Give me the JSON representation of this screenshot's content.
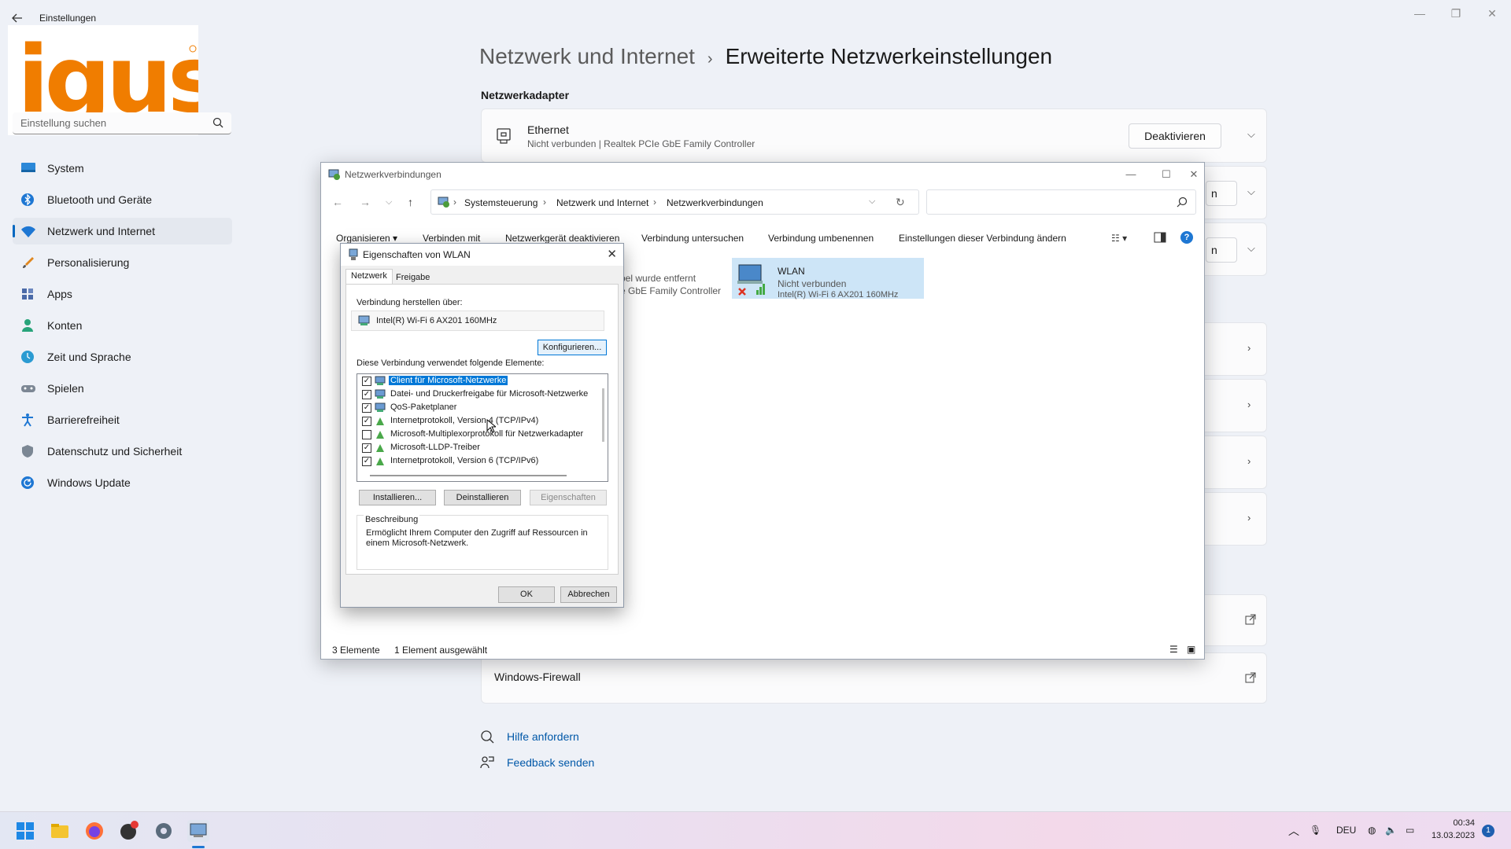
{
  "settings": {
    "title": "Einstellungen",
    "search_placeholder": "Einstellung suchen",
    "nav": [
      {
        "label": "System",
        "icon": "monitor-icon"
      },
      {
        "label": "Bluetooth und Geräte",
        "icon": "bluetooth-icon"
      },
      {
        "label": "Netzwerk und Internet",
        "icon": "wifi-icon"
      },
      {
        "label": "Personalisierung",
        "icon": "brush-icon"
      },
      {
        "label": "Apps",
        "icon": "apps-icon"
      },
      {
        "label": "Konten",
        "icon": "person-icon"
      },
      {
        "label": "Zeit und Sprache",
        "icon": "globe-clock-icon"
      },
      {
        "label": "Spielen",
        "icon": "gamepad-icon"
      },
      {
        "label": "Barrierefreiheit",
        "icon": "accessibility-icon"
      },
      {
        "label": "Datenschutz und Sicherheit",
        "icon": "shield-icon"
      },
      {
        "label": "Windows Update",
        "icon": "refresh-icon"
      }
    ],
    "breadcrumb": {
      "parent": "Netzwerk und Internet",
      "separator": "›",
      "current": "Erweiterte Netzwerkeinstellungen"
    },
    "section_title": "Netzwerkadapter",
    "ethernet": {
      "name": "Ethernet",
      "desc": "Nicht verbunden | Realtek PCIe GbE Family Controller",
      "button": "Deaktivieren"
    },
    "partial_button_1": "n",
    "partial_button_2": "n",
    "firewall": "Windows-Firewall",
    "help": "Hilfe anfordern",
    "feedback": "Feedback senden"
  },
  "logo": {
    "text": "igus",
    "color": "#f07d00"
  },
  "netconn": {
    "title": "Netzwerkverbindungen",
    "path": [
      "Systemsteuerung",
      "Netzwerk und Internet",
      "Netzwerkverbindungen"
    ],
    "toolbar": [
      "Organisieren ▾",
      "Verbinden mit",
      "Netzwerkgerät deaktivieren",
      "Verbindung untersuchen",
      "Verbindung umbenennen",
      "Einstellungen dieser Verbindung ändern"
    ],
    "ethernet_tile": {
      "line1": "bel wurde entfernt",
      "line2": "e GbE Family Controller"
    },
    "wlan_tile": {
      "name": "WLAN",
      "status": "Nicht verbunden",
      "adapter": "Intel(R) Wi-Fi 6 AX201 160MHz"
    },
    "status_count": "3 Elemente",
    "status_selected": "1 Element ausgewählt"
  },
  "props": {
    "title": "Eigenschaften von WLAN",
    "tabs": [
      "Netzwerk",
      "Freigabe"
    ],
    "connect_via_label": "Verbindung herstellen über:",
    "adapter": "Intel(R) Wi-Fi 6 AX201 160MHz",
    "configure_button": "Konfigurieren...",
    "items_label": "Diese Verbindung verwendet folgende Elemente:",
    "items": [
      {
        "label": "Client für Microsoft-Netzwerke",
        "checked": true,
        "selected": true
      },
      {
        "label": "Datei- und Druckerfreigabe für Microsoft-Netzwerke",
        "checked": true
      },
      {
        "label": "QoS-Paketplaner",
        "checked": true
      },
      {
        "label": "Internetprotokoll, Version 4 (TCP/IPv4)",
        "checked": true
      },
      {
        "label": "Microsoft-Multiplexorprotokoll für Netzwerkadapter",
        "checked": false
      },
      {
        "label": "Microsoft-LLDP-Treiber",
        "checked": true
      },
      {
        "label": "Internetprotokoll, Version 6 (TCP/IPv6)",
        "checked": true
      }
    ],
    "install_button": "Installieren...",
    "uninstall_button": "Deinstallieren",
    "properties_button": "Eigenschaften",
    "description_label": "Beschreibung",
    "description": "Ermöglicht Ihrem Computer den Zugriff auf Ressourcen in einem Microsoft-Netzwerk.",
    "ok": "OK",
    "cancel": "Abbrechen"
  },
  "taskbar": {
    "apps": [
      "start-icon",
      "file-explorer-icon",
      "firefox-icon",
      "record-app-icon",
      "settings-gear-icon",
      "network-connections-icon"
    ],
    "lang": "DEU",
    "time": "00:34",
    "date": "13.03.2023",
    "notification_count": "1"
  }
}
